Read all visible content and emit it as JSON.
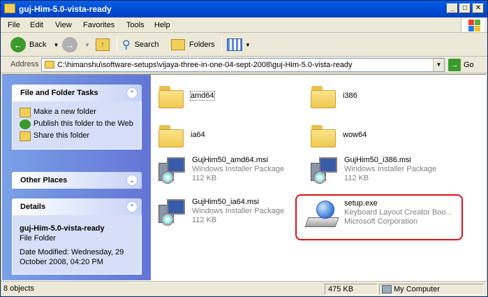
{
  "window": {
    "title": "guj-Him-5.0-vista-ready",
    "min_label": "_",
    "max_label": "□",
    "close_label": "✕"
  },
  "menu": [
    "File",
    "Edit",
    "View",
    "Favorites",
    "Tools",
    "Help"
  ],
  "toolbar": {
    "back_label": "Back",
    "search_label": "Search",
    "folders_label": "Folders"
  },
  "address": {
    "label": "Address",
    "value": "C:\\himanshu\\software-setups\\vijaya-three-in-one-04-sept-2008\\guj-Him-5.0-vista-ready",
    "go_label": "Go"
  },
  "tasks_panel": {
    "title": "File and Folder Tasks",
    "items": [
      "Make a new folder",
      "Publish this folder to the Web",
      "Share this folder"
    ]
  },
  "other_places": {
    "title": "Other Places"
  },
  "details": {
    "title": "Details",
    "name": "guj-Him-5.0-vista-ready",
    "type": "File Folder",
    "modified": "Date Modified: Wednesday, 29 October 2008, 04:20 PM"
  },
  "folders": [
    "amd64",
    "i386",
    "ia64",
    "wow64"
  ],
  "files": [
    {
      "name": "GujHim50_amd64.msi",
      "type": "Windows Installer Package",
      "size": "112 KB"
    },
    {
      "name": "GujHim50_i386.msi",
      "type": "Windows Installer Package",
      "size": "112 KB"
    },
    {
      "name": "GujHim50_ia64.msi",
      "type": "Windows Installer Package",
      "size": "112 KB"
    },
    {
      "name": "setup.exe",
      "type": "Keyboard Layout Creator Boo...",
      "size": "Microsoft Corporation"
    }
  ],
  "status": {
    "objects": "8 objects",
    "size": "475 KB",
    "zone": "My Computer"
  },
  "colors": {
    "titlebar": "#0050d8",
    "highlight": "#e01010",
    "task_pane": "#6375d6"
  }
}
